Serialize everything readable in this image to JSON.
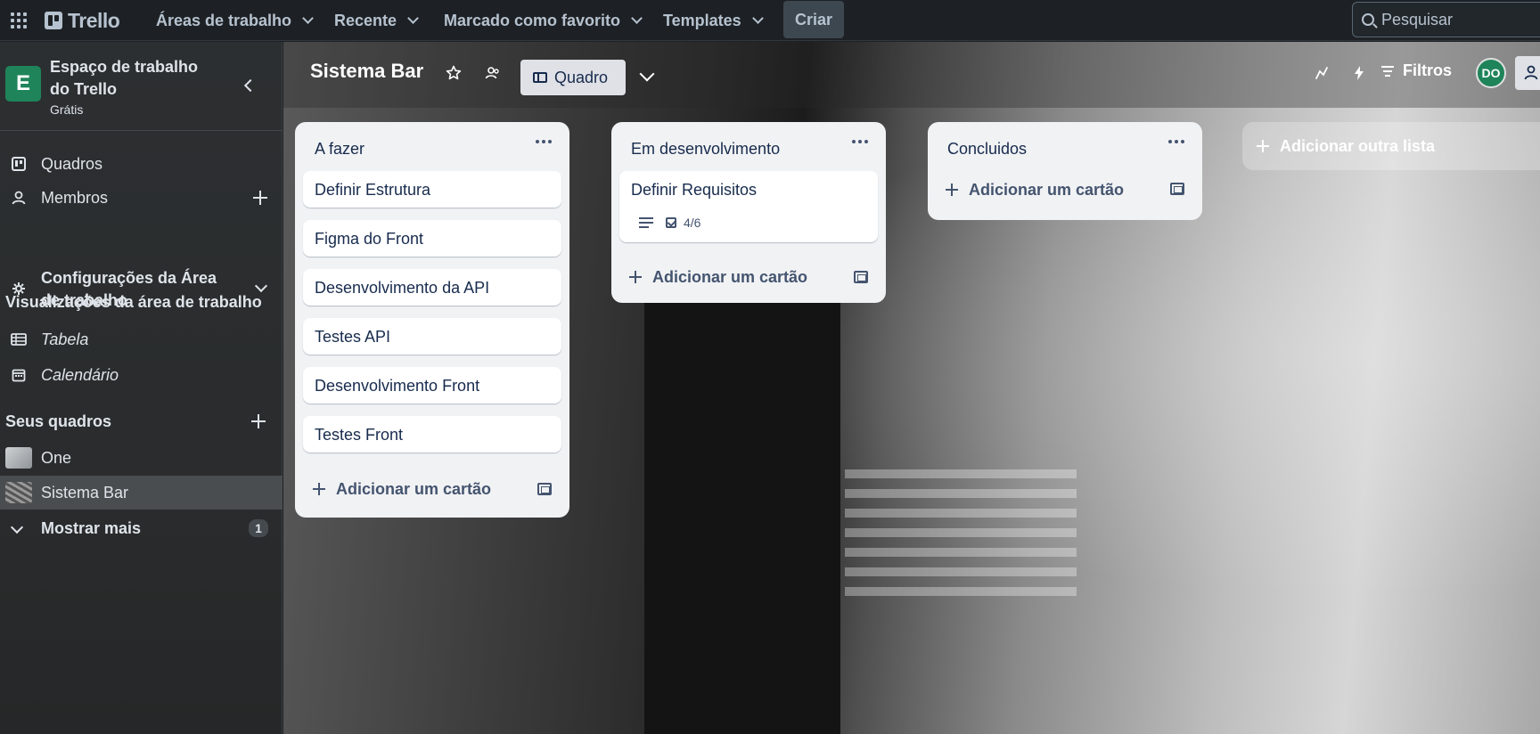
{
  "topnav": {
    "logo_text": "Trello",
    "menus": [
      "Áreas de trabalho",
      "Recente",
      "Marcado como favorito",
      "Templates"
    ],
    "create_label": "Criar",
    "search_placeholder": "Pesquisar"
  },
  "sidebar": {
    "workspace_initial": "E",
    "workspace_name": "Espaço de trabalho do Trello",
    "workspace_plan": "Grátis",
    "items": [
      {
        "label": "Quadros",
        "icon": "board-icon"
      },
      {
        "label": "Membros",
        "icon": "person-icon"
      },
      {
        "label": "Configurações da Área de trabalho",
        "icon": "gear-icon"
      }
    ],
    "views_section": "Visualizações da área de trabalho",
    "views": [
      {
        "label": "Tabela",
        "icon": "table-icon"
      },
      {
        "label": "Calendário",
        "icon": "calendar-icon"
      }
    ],
    "boards_section": "Seus quadros",
    "boards": [
      "One",
      "Sistema Bar"
    ],
    "show_more": "Mostrar mais",
    "show_more_count": "1"
  },
  "board": {
    "title": "Sistema Bar",
    "view_label": "Quadro",
    "filters_label": "Filtros",
    "member_initials": "DO",
    "add_list_label": "Adicionar outra lista",
    "lists": [
      {
        "title": "A fazer",
        "cards": [
          "Definir Estrutura",
          "Figma do Front",
          "Desenvolvimento da API",
          "Testes API",
          "Desenvolvimento Front",
          "Testes Front"
        ],
        "add_label": "Adicionar um cartão"
      },
      {
        "title": "Em desenvolvimento",
        "cards": [
          "Definir Requisitos"
        ],
        "checklist": "4/6",
        "add_label": "Adicionar um cartão"
      },
      {
        "title": "Concluidos",
        "cards": [],
        "add_label": "Adicionar um cartão"
      }
    ]
  },
  "colors": {
    "workspace_green": "#1f845a",
    "list_bg": "#f1f2f4",
    "nav_bg": "#1d2125"
  }
}
